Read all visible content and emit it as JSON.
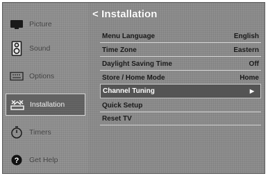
{
  "sidebar": {
    "items": [
      {
        "label": "Picture",
        "icon": "tv-icon"
      },
      {
        "label": "Sound",
        "icon": "speaker-icon"
      },
      {
        "label": "Options",
        "icon": "keyboard-icon"
      },
      {
        "label": "Installation",
        "icon": "installation-icon"
      },
      {
        "label": "Timers",
        "icon": "timer-icon"
      },
      {
        "label": "Get Help",
        "icon": "help-icon"
      }
    ],
    "selected": "Installation"
  },
  "main": {
    "title": "< Installation",
    "menu": [
      {
        "label": "Menu Language",
        "value": "English"
      },
      {
        "label": "Time Zone",
        "value": "Eastern"
      },
      {
        "label": "Daylight Saving Time",
        "value": "Off"
      },
      {
        "label": "Store / Home Mode",
        "value": "Home"
      },
      {
        "label": "Channel Tuning",
        "value": "▶"
      },
      {
        "label": "Quick Setup",
        "value": ""
      },
      {
        "label": "Reset TV",
        "value": ""
      }
    ],
    "highlighted": "Channel Tuning"
  },
  "colors": {
    "background": "#8a8a8a",
    "highlight": "#545454",
    "text_dark": "#1a1a1a",
    "title": "#ffffff"
  }
}
